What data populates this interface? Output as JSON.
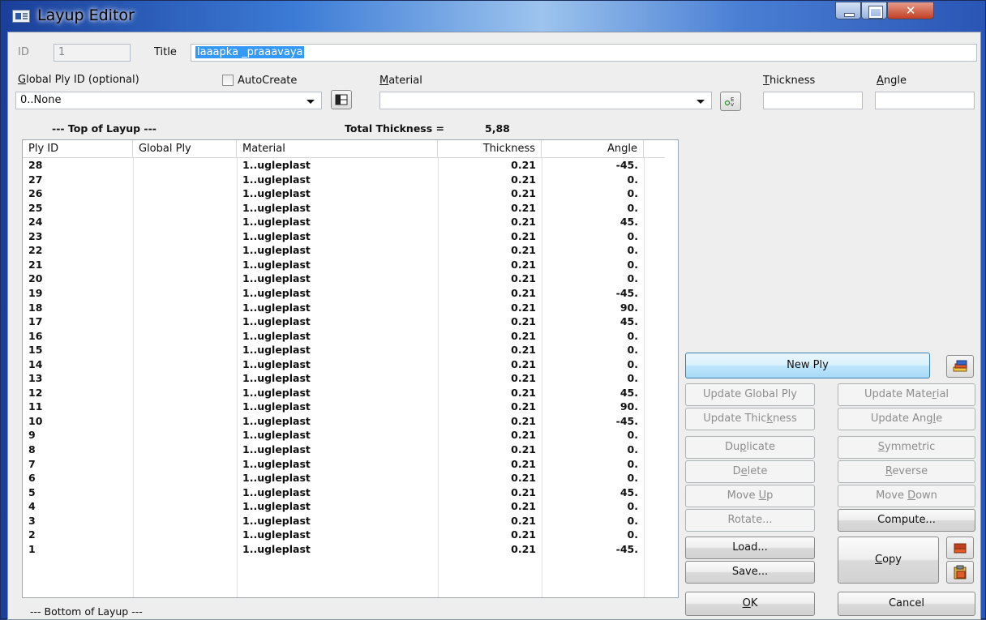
{
  "window": {
    "title": "Layup Editor"
  },
  "header": {
    "id_label": "ID",
    "id_value": "1",
    "title_label": "Title",
    "title_value": "laaapka _praaavaya",
    "global_ply_label": "Global Ply ID (optional)",
    "global_ply_value": "0..None",
    "autocreate_label": "AutoCreate",
    "material_label": "Material",
    "material_value": "",
    "thickness_label": "Thickness",
    "thickness_value": "",
    "angle_label": "Angle",
    "angle_value": ""
  },
  "layup": {
    "top_label": "--- Top of Layup ---",
    "total_label": "Total Thickness =",
    "total_value": "5,88",
    "bottom_label": "--- Bottom of Layup ---",
    "columns": [
      "Ply ID",
      "Global Ply",
      "Material",
      "Thickness",
      "Angle"
    ],
    "rows": [
      {
        "id": "28",
        "global": "",
        "material": "1..ugleplast",
        "thickness": "0.21",
        "angle": "-45."
      },
      {
        "id": "27",
        "global": "",
        "material": "1..ugleplast",
        "thickness": "0.21",
        "angle": "0."
      },
      {
        "id": "26",
        "global": "",
        "material": "1..ugleplast",
        "thickness": "0.21",
        "angle": "0."
      },
      {
        "id": "25",
        "global": "",
        "material": "1..ugleplast",
        "thickness": "0.21",
        "angle": "0."
      },
      {
        "id": "24",
        "global": "",
        "material": "1..ugleplast",
        "thickness": "0.21",
        "angle": "45."
      },
      {
        "id": "23",
        "global": "",
        "material": "1..ugleplast",
        "thickness": "0.21",
        "angle": "0."
      },
      {
        "id": "22",
        "global": "",
        "material": "1..ugleplast",
        "thickness": "0.21",
        "angle": "0."
      },
      {
        "id": "21",
        "global": "",
        "material": "1..ugleplast",
        "thickness": "0.21",
        "angle": "0."
      },
      {
        "id": "20",
        "global": "",
        "material": "1..ugleplast",
        "thickness": "0.21",
        "angle": "0."
      },
      {
        "id": "19",
        "global": "",
        "material": "1..ugleplast",
        "thickness": "0.21",
        "angle": "-45."
      },
      {
        "id": "18",
        "global": "",
        "material": "1..ugleplast",
        "thickness": "0.21",
        "angle": "90."
      },
      {
        "id": "17",
        "global": "",
        "material": "1..ugleplast",
        "thickness": "0.21",
        "angle": "45."
      },
      {
        "id": "16",
        "global": "",
        "material": "1..ugleplast",
        "thickness": "0.21",
        "angle": "0."
      },
      {
        "id": "15",
        "global": "",
        "material": "1..ugleplast",
        "thickness": "0.21",
        "angle": "0."
      },
      {
        "id": "14",
        "global": "",
        "material": "1..ugleplast",
        "thickness": "0.21",
        "angle": "0."
      },
      {
        "id": "13",
        "global": "",
        "material": "1..ugleplast",
        "thickness": "0.21",
        "angle": "0."
      },
      {
        "id": "12",
        "global": "",
        "material": "1..ugleplast",
        "thickness": "0.21",
        "angle": "45."
      },
      {
        "id": "11",
        "global": "",
        "material": "1..ugleplast",
        "thickness": "0.21",
        "angle": "90."
      },
      {
        "id": "10",
        "global": "",
        "material": "1..ugleplast",
        "thickness": "0.21",
        "angle": "-45."
      },
      {
        "id": "9",
        "global": "",
        "material": "1..ugleplast",
        "thickness": "0.21",
        "angle": "0."
      },
      {
        "id": "8",
        "global": "",
        "material": "1..ugleplast",
        "thickness": "0.21",
        "angle": "0."
      },
      {
        "id": "7",
        "global": "",
        "material": "1..ugleplast",
        "thickness": "0.21",
        "angle": "0."
      },
      {
        "id": "6",
        "global": "",
        "material": "1..ugleplast",
        "thickness": "0.21",
        "angle": "0."
      },
      {
        "id": "5",
        "global": "",
        "material": "1..ugleplast",
        "thickness": "0.21",
        "angle": "45."
      },
      {
        "id": "4",
        "global": "",
        "material": "1..ugleplast",
        "thickness": "0.21",
        "angle": "0."
      },
      {
        "id": "3",
        "global": "",
        "material": "1..ugleplast",
        "thickness": "0.21",
        "angle": "0."
      },
      {
        "id": "2",
        "global": "",
        "material": "1..ugleplast",
        "thickness": "0.21",
        "angle": "0."
      },
      {
        "id": "1",
        "global": "",
        "material": "1..ugleplast",
        "thickness": "0.21",
        "angle": "-45."
      }
    ]
  },
  "buttons": {
    "new_ply": "New Ply",
    "update_global_ply": "Update Global Ply",
    "update_material": "Update Material",
    "update_thickness": "Update Thickness",
    "update_angle": "Update Angle",
    "duplicate": "Duplicate",
    "symmetric": "Symmetric",
    "delete": "Delete",
    "reverse": "Reverse",
    "move_up": "Move Up",
    "move_down": "Move Down",
    "rotate": "Rotate...",
    "compute": "Compute...",
    "load": "Load...",
    "save": "Save...",
    "copy": "Copy",
    "ok": "OK",
    "cancel": "Cancel"
  },
  "colors": {
    "selection": "#3399ff",
    "primary_button": "#bee6fd",
    "titlebar": "#3c7bd6"
  }
}
